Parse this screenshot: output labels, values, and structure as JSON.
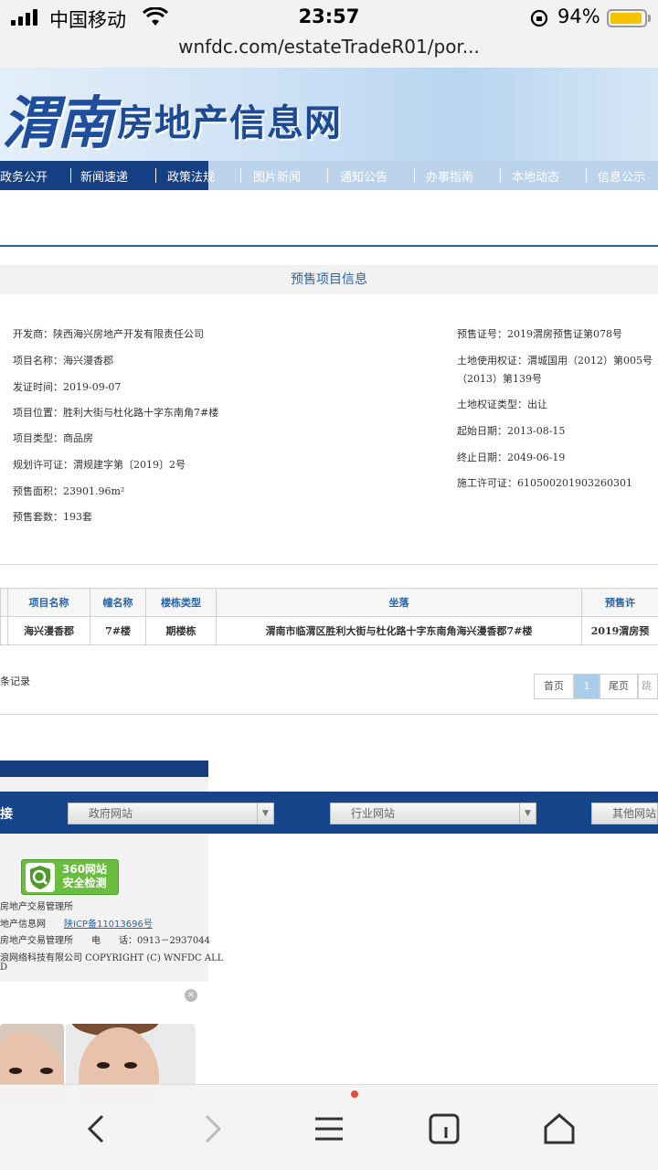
{
  "status_bar": {
    "carrier": "中国移动",
    "time": "23:57",
    "battery": "94%",
    "battery_level": 0.94
  },
  "browser": {
    "url": "wnfdc.com/estateTradeR01/por..."
  },
  "site": {
    "logo_text": "渭南",
    "title": "房地产信息网",
    "nav": [
      "政务公开",
      "新闻速递",
      "政策法规",
      "图片新闻",
      "通知公告",
      "办事指南",
      "本地动态",
      "信息公示"
    ]
  },
  "section_title": "预售项目信息",
  "project": {
    "left": [
      {
        "label": "开发商：",
        "value": "陕西海兴房地产开发有限责任公司"
      },
      {
        "label": "项目名称：",
        "value": "海兴漫香郡"
      },
      {
        "label": "发证时间：",
        "value": "2019-09-07"
      },
      {
        "label": "项目位置：",
        "value": "胜利大街与杜化路十字东南角7#楼"
      },
      {
        "label": "项目类型：",
        "value": "商品房"
      },
      {
        "label": "规划许可证：",
        "value": "渭规建字第〔2019〕2号"
      },
      {
        "label": "预售面积：",
        "value": "23901.96m²"
      },
      {
        "label": "预售套数：",
        "value": "193套"
      }
    ],
    "right": [
      {
        "label": "预售证号：",
        "value": "2019渭房预售证第078号"
      },
      {
        "label": "土地使用权证：",
        "value": "渭城国用（2012）第005号"
      },
      {
        "label": "",
        "value": "（2013）第139号"
      },
      {
        "label": "土地权证类型：",
        "value": "出让"
      },
      {
        "label": "起始日期：",
        "value": "2013-08-15"
      },
      {
        "label": "终止日期：",
        "value": "2049-06-19"
      },
      {
        "label": "施工许可证：",
        "value": "610500201903260301"
      }
    ]
  },
  "table": {
    "headers": [
      "项目名称",
      "幢名称",
      "楼栋类型",
      "坐落",
      "预售许"
    ],
    "rows": [
      [
        "海兴漫香郡",
        "7#楼",
        "期楼栋",
        "渭南市临渭区胜利大街与杜化路十字东南角海兴漫香郡7#楼",
        "2019渭房预"
      ]
    ]
  },
  "records_text": "条记录",
  "pager": {
    "first": "首页",
    "current": "1",
    "last": "尾页",
    "jump": "跳转"
  },
  "links": {
    "title": "接",
    "selects": [
      "政府网站",
      "行业网站",
      "其他网站"
    ]
  },
  "badge": {
    "line1": "360网站",
    "line2": "安全检测"
  },
  "footer": {
    "line1": "房地产交易管理所",
    "line2_a": "地产信息网",
    "line2_link": "陕ICP备11013696号",
    "line3_a": "房地产交易管理所",
    "line3_tel_label": "电　　话：",
    "line3_tel": "0913－2937044",
    "line4": "浪网络科技有限公司 COPYRIGHT (C) WNFDC ALL",
    "line5": "D"
  },
  "ad": {
    "close": "×"
  }
}
